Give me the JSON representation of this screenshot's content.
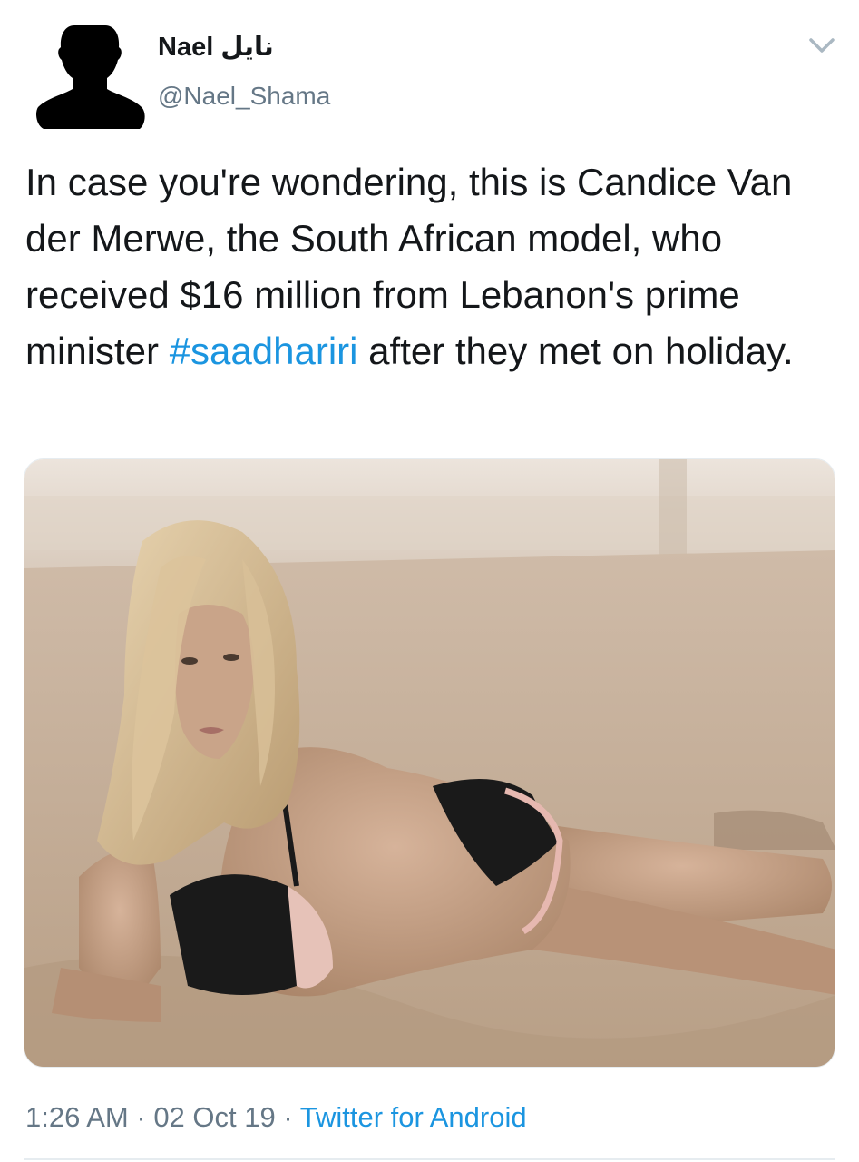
{
  "tweet": {
    "author": {
      "display_name": "Nael",
      "display_name_arabic": "نايل",
      "handle": "@Nael_Shama",
      "avatar_icon": "silhouette-avatar-icon"
    },
    "menu_icon": "chevron-down-icon",
    "text": {
      "before_hashtag": "In case you're wondering, this is Candice Van der Merwe, the South African model, who received $16 million from Lebanon's prime minister ",
      "hashtag": "#saadhariri",
      "after_hashtag": " after they met on holiday."
    },
    "media": {
      "type": "photo",
      "subject": "woman-on-beach-photo"
    },
    "footer": {
      "time": "1:26 AM",
      "separator1": " · ",
      "date": "02 Oct 19",
      "separator2": " · ",
      "source": "Twitter for Android"
    }
  },
  "colors": {
    "link": "#1b95e0",
    "secondary_text": "#657786",
    "primary_text": "#14171a",
    "divider": "#e6ecf0"
  }
}
